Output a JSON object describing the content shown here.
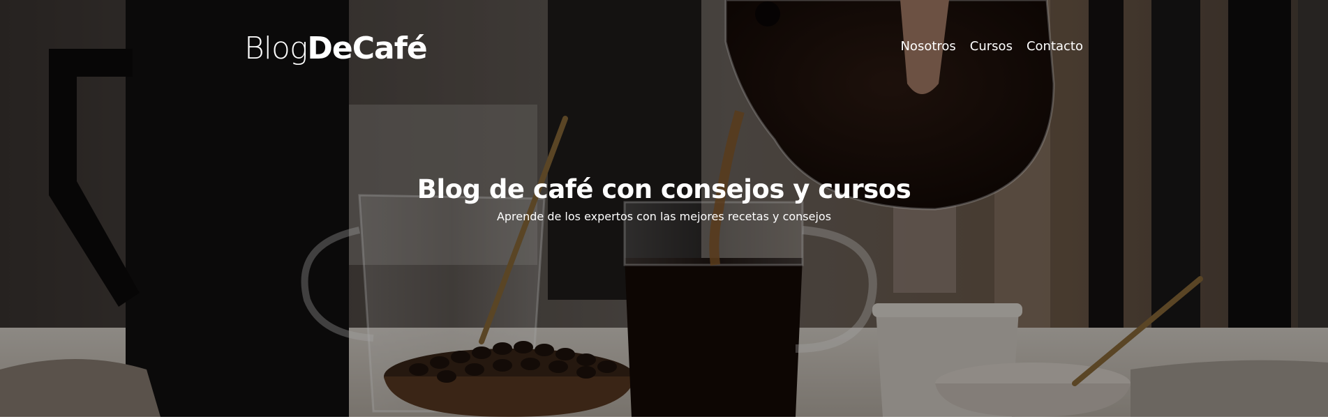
{
  "header": {
    "logo_light": "Blog",
    "logo_bold": "DeCafé"
  },
  "nav": {
    "items": [
      {
        "label": "Nosotros"
      },
      {
        "label": "Cursos"
      },
      {
        "label": "Contacto"
      }
    ]
  },
  "hero": {
    "title": "Blog de café con consejos y cursos",
    "subtitle": "Aprende de los expertos con las mejores recetas y consejos"
  },
  "colors": {
    "text": "#ffffff",
    "overlay": "rgba(0,0,0,0.35)",
    "coffee": "#1a0e0a",
    "background_warm": "#3a2f2a"
  },
  "icons": {
    "hero_image": "coffee-pouring-photo"
  }
}
